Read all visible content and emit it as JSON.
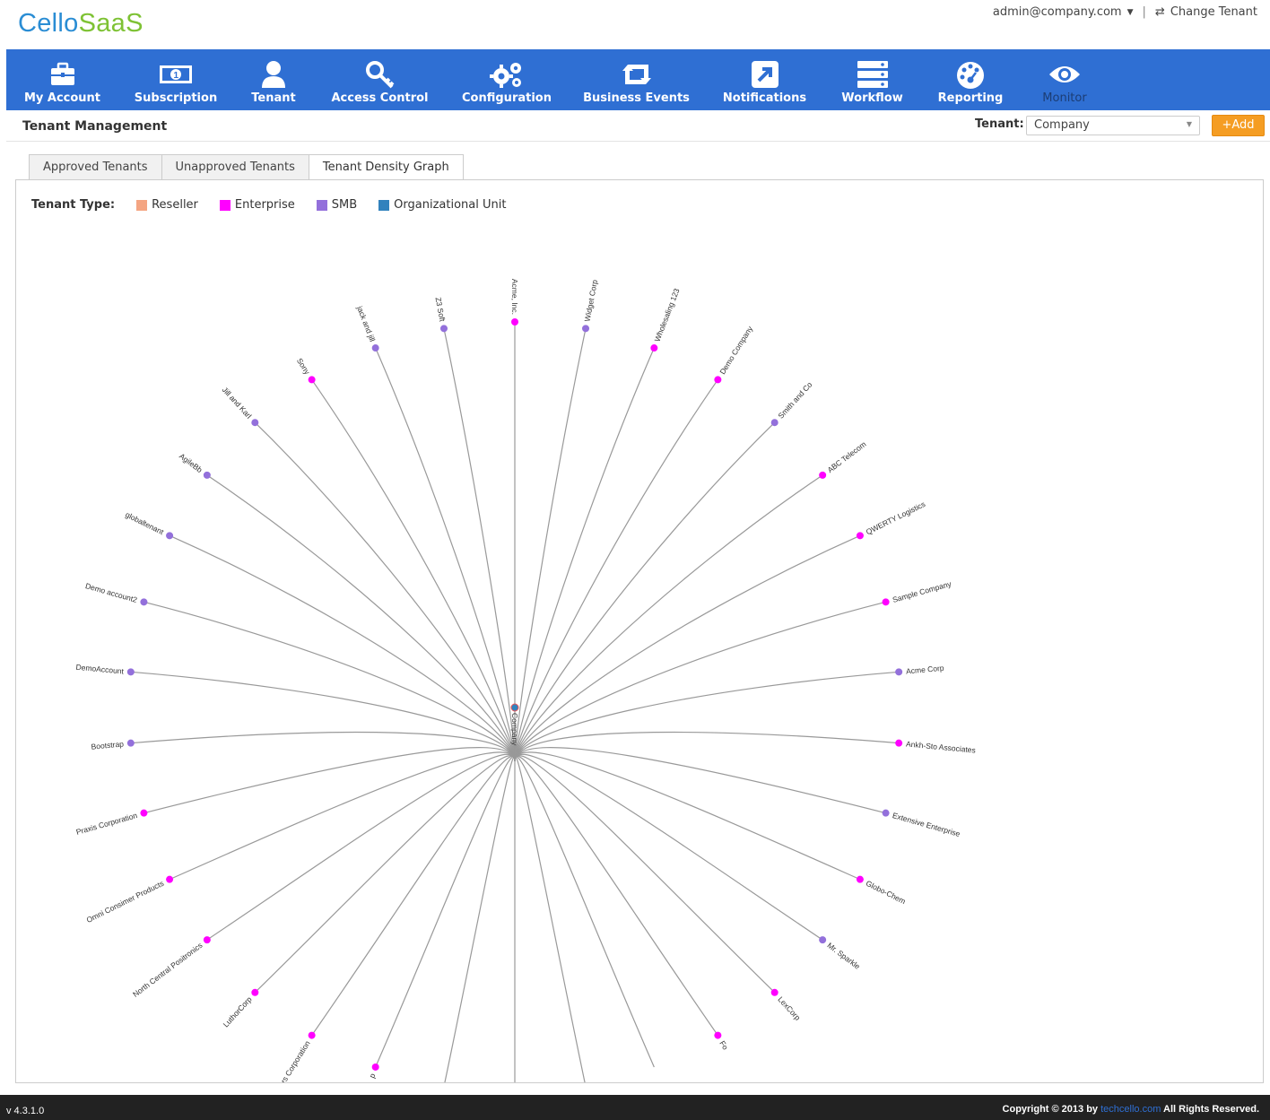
{
  "brand": {
    "part1": "Cello",
    "part2": "SaaS"
  },
  "user": {
    "email": "admin@company.com",
    "change_tenant": "Change Tenant"
  },
  "nav": [
    {
      "label": "My Account",
      "icon": "briefcase-icon"
    },
    {
      "label": "Subscription",
      "icon": "money-icon"
    },
    {
      "label": "Tenant",
      "icon": "user-icon"
    },
    {
      "label": "Access Control",
      "icon": "key-icon"
    },
    {
      "label": "Configuration",
      "icon": "gears-icon"
    },
    {
      "label": "Business Events",
      "icon": "retweet-icon"
    },
    {
      "label": "Notifications",
      "icon": "external-link-icon"
    },
    {
      "label": "Workflow",
      "icon": "server-icon"
    },
    {
      "label": "Reporting",
      "icon": "dashboard-icon"
    },
    {
      "label": "Monitor",
      "icon": "eye-icon"
    }
  ],
  "page": {
    "title": "Tenant Management",
    "tenant_label": "Tenant:",
    "tenant_value": "Company",
    "add_label": "+Add"
  },
  "tabs": [
    "Approved Tenants",
    "Unapproved Tenants",
    "Tenant Density Graph"
  ],
  "legend": {
    "title": "Tenant Type:",
    "items": [
      {
        "label": "Reseller",
        "color": "#f4a582"
      },
      {
        "label": "Enterprise",
        "color": "#ff00ff"
      },
      {
        "label": "SMB",
        "color": "#9370db"
      },
      {
        "label": "Organizational Unit",
        "color": "#3182bd"
      }
    ]
  },
  "graph": {
    "root": "Company",
    "root_color": "#3182bd",
    "nodes": [
      {
        "name": "Widget Corp",
        "type": "SMB"
      },
      {
        "name": "Wholesaling 123",
        "type": "Enterprise"
      },
      {
        "name": "Demo Company",
        "type": "Enterprise"
      },
      {
        "name": "Smith and Co",
        "type": "SMB"
      },
      {
        "name": "ABC Telecom",
        "type": "Enterprise"
      },
      {
        "name": "QWERTY Logistics",
        "type": "Enterprise"
      },
      {
        "name": "Sample Company",
        "type": "Enterprise"
      },
      {
        "name": "Acme Corp",
        "type": "SMB"
      },
      {
        "name": "Ankh-Sto Associates",
        "type": "Enterprise"
      },
      {
        "name": "Extensive Enterprise",
        "type": "SMB"
      },
      {
        "name": "Globo-Chem",
        "type": "Enterprise"
      },
      {
        "name": "Mr. Sparkle",
        "type": "SMB"
      },
      {
        "name": "LexCorp",
        "type": "Enterprise"
      },
      {
        "name": "Fo",
        "type": "Enterprise"
      },
      {
        "name": "",
        "type": ""
      },
      {
        "name": "",
        "type": ""
      },
      {
        "name": "",
        "type": ""
      },
      {
        "name": "",
        "type": ""
      },
      {
        "name": "p",
        "type": "Enterprise"
      },
      {
        "name": "rs Corporation",
        "type": "Enterprise"
      },
      {
        "name": "LuthorCorp",
        "type": "Enterprise"
      },
      {
        "name": "North Central Positronics",
        "type": "Enterprise"
      },
      {
        "name": "Omni Consimer Products",
        "type": "Enterprise"
      },
      {
        "name": "Praxis Corporation",
        "type": "Enterprise"
      },
      {
        "name": "Bootstrap",
        "type": "SMB"
      },
      {
        "name": "DemoAccount",
        "type": "SMB"
      },
      {
        "name": "Demo account2",
        "type": "SMB"
      },
      {
        "name": "globaltenant",
        "type": "SMB"
      },
      {
        "name": "AgileBb",
        "type": "SMB"
      },
      {
        "name": "Jill and Karl",
        "type": "SMB"
      },
      {
        "name": "Sony",
        "type": "Enterprise"
      },
      {
        "name": "jack and jill",
        "type": "SMB"
      },
      {
        "name": "Z3 Soft",
        "type": "SMB"
      },
      {
        "name": "Acme, Inc.",
        "type": "Enterprise"
      }
    ]
  },
  "footer": {
    "version": "v 4.3.1.0",
    "copyright_pre": "Copyright © 2013 by ",
    "copyright_link": "techcello.com",
    "copyright_post": " All Rights Reserved."
  }
}
